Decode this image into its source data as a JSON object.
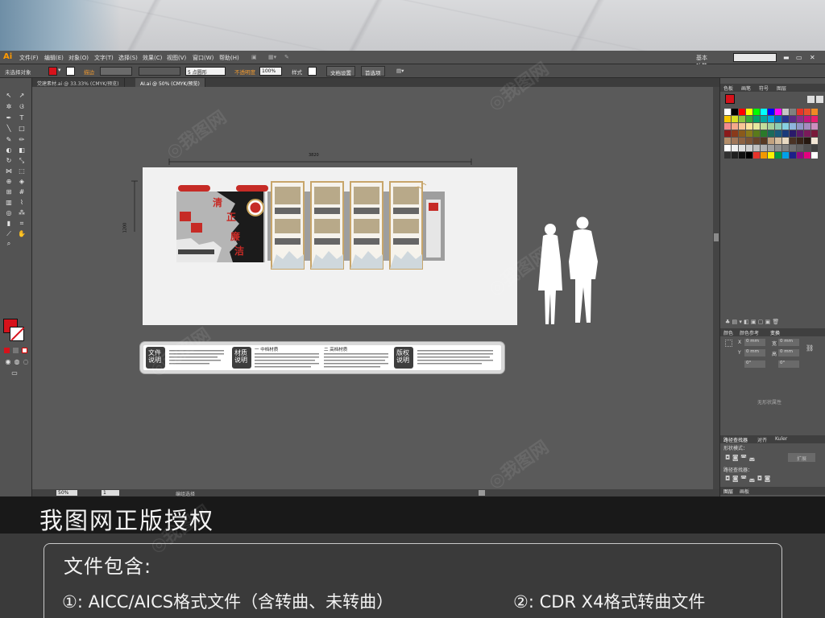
{
  "menubar": {
    "items": [
      "文件(F)",
      "编辑(E)",
      "对象(O)",
      "文字(T)",
      "选择(S)",
      "效果(C)",
      "视图(V)",
      "窗口(W)",
      "帮助(H)"
    ],
    "workspace": "基本功能"
  },
  "controlbar": {
    "no_selection": "未选择对象",
    "stroke_label": "描边",
    "stroke_value": "",
    "brush_value": "5 点圆形",
    "opacity_label": "不透明度",
    "opacity_value": "100%",
    "style_label": "样式",
    "doc_setup": "文档设置",
    "preferences": "首选项"
  },
  "tabs": [
    {
      "label": "党建素材.ai @ 33.33% (CMYK/预览)"
    },
    {
      "label": "AI.ai @ 50% (CMYK/预览)"
    }
  ],
  "canvas": {
    "dim_width": "3820",
    "dim_height": "1200",
    "panel_slogan": "老党员  拥毛泽东  初心守护  不忘初心  勤政为民",
    "board_words": [
      "立党为公",
      "执政为民",
      "清",
      "正",
      "廉",
      "洁",
      "先进党员",
      "模范事迹"
    ],
    "card_title": "优秀党员",
    "right_tag": "廉洁文化"
  },
  "infostrip": {
    "wenjian": "文件说明",
    "caizhi": "材质说明",
    "mid_title": "一 中档材质",
    "high_title": "二 高档材质",
    "banquan": "版权说明"
  },
  "rpanel": {
    "tabs1": [
      "色板",
      "画笔",
      "符号",
      "图层"
    ],
    "tabs2": [
      "颜色",
      "颜色参考",
      "变换"
    ],
    "transform_x": "0 mm",
    "transform_y": "0 mm",
    "transform_w": "0 mm",
    "transform_h": "0 mm",
    "transform_angle": "0°",
    "no_shape": "无形状属性",
    "tabs3": [
      "路径查找器",
      "对齐",
      "Kuler"
    ],
    "shape_mode": "形状模式：",
    "expand": "扩展",
    "pathfinder": "路径查找器：",
    "tabs4": [
      "图层",
      "画板"
    ]
  },
  "statusbar": {
    "zoom": "50%",
    "page": "1",
    "mode": "编组选择"
  },
  "banner": {
    "title": "我图网正版授权"
  },
  "filebox": {
    "heading": "文件包含:",
    "item1": "①: AICC/AICS格式文件（含转曲、未转曲）",
    "item2": "②: CDR X4格式转曲文件"
  },
  "colors": {
    "red": "#d6121b",
    "gold": "#c7a56a",
    "accent_orange": "#ff9a00"
  }
}
